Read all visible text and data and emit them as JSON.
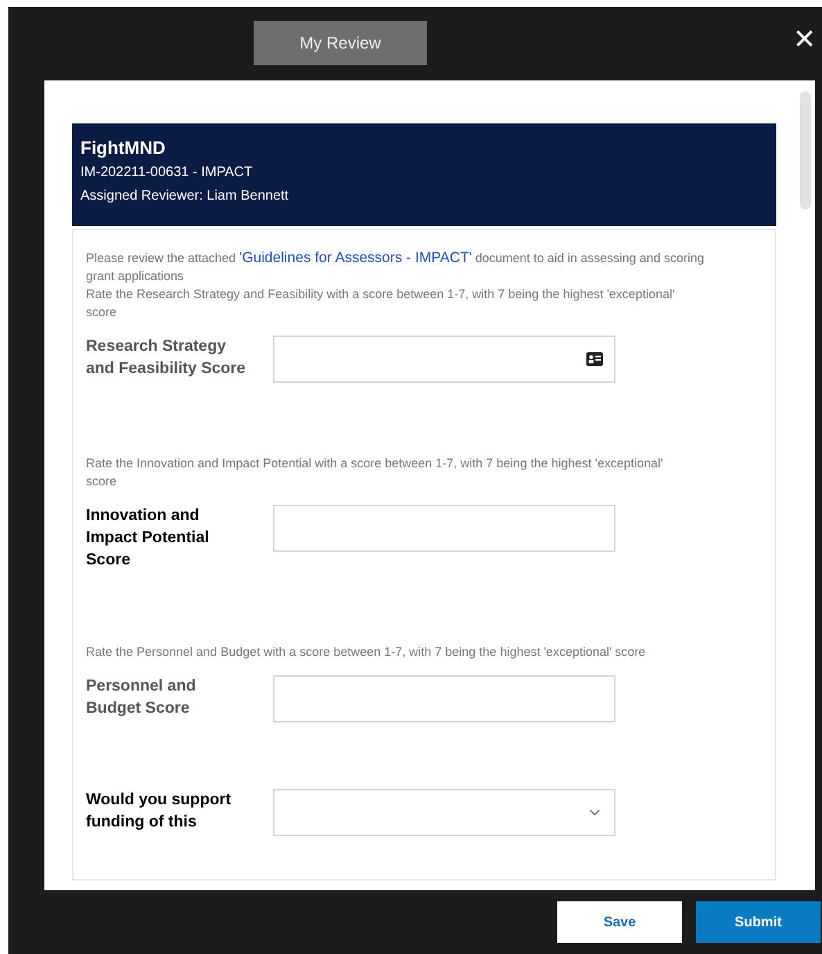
{
  "tab": {
    "label": "My Review",
    "selected": true
  },
  "close": {
    "label": "✕"
  },
  "header": {
    "title": "FightMND",
    "reference": "IM-202211-00631 - IMPACT",
    "reviewer": "Assigned Reviewer: Liam Bennett"
  },
  "intro": {
    "before": "Please review the attached ",
    "link": "'Guidelines for Assessors - IMPACT'",
    "after": " document to aid in assessing and scoring grant applications"
  },
  "questions": [
    {
      "description": "Rate the Research Strategy and Feasibility with a score between 1-7, with 7 being the highest 'exceptional' score",
      "label": "Research Strategy and Feasibility Score",
      "strong": false,
      "kind": "autofill"
    },
    {
      "description": "Rate the Innovation and Impact Potential with a score between 1-7, with 7 being the highest 'exceptional' score",
      "label": "Innovation and Impact Potential Score",
      "strong": true,
      "kind": "text"
    },
    {
      "description": "Rate the Personnel and Budget with a score between 1-7, with 7 being the highest 'exceptional' score",
      "label": "Personnel and Budget Score",
      "strong": false,
      "kind": "text"
    },
    {
      "label": "Would you support funding of this",
      "strong": true,
      "kind": "select"
    }
  ],
  "buttons": [
    {
      "label": "Save",
      "kind": "secondary"
    },
    {
      "label": "Submit",
      "kind": "primary"
    }
  ]
}
